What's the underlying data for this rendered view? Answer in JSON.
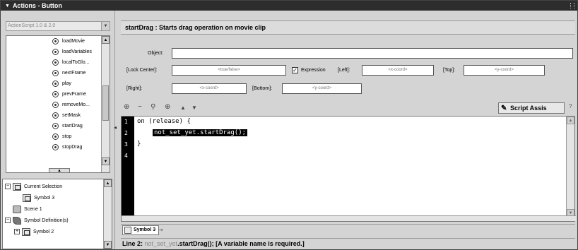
{
  "window": {
    "title": "Actions - Button"
  },
  "left_panel": {
    "language_select": "ActionScript 1.0 & 2.0",
    "toolbox_items": [
      "loadMovie",
      "loadVariables",
      "localToGlo...",
      "nextFrame",
      "play",
      "prevFrame",
      "removeMo...",
      "setMask",
      "startDrag",
      "stop",
      "stopDrag"
    ],
    "tree": {
      "current_selection": "Current Selection",
      "symbol3": "Symbol 3",
      "scene1": "Scene 1",
      "symbol_definitions": "Symbol Definition(s)",
      "symbol2": "Symbol 2"
    }
  },
  "header": {
    "title": "startDrag : Starts drag operation on movie clip"
  },
  "params": {
    "object_label": "Object:",
    "object_value": "",
    "lock_center_label": "[Lock Center]:",
    "lock_center_placeholder": "<true/false>",
    "expression_label": "Expression",
    "left_label": "[Left]:",
    "left_placeholder": "<x-coord>",
    "top_label": "[Top]:",
    "top_placeholder": "<y-coord>",
    "right_label": "[Right]:",
    "right_placeholder": "<x-coord>",
    "bottom_label": "[Bottom]:",
    "bottom_placeholder": "<y-coord>"
  },
  "toolbar": {
    "script_assist_label": "Script Assis"
  },
  "editor": {
    "line_numbers": [
      "1",
      "2",
      "3",
      "4"
    ],
    "line1": "on (release) {",
    "line2": "not_set_yet.startDrag();",
    "line3": "}"
  },
  "tabs": {
    "symbol3": "Symbol 3"
  },
  "status": {
    "prefix": "Line 2: ",
    "muted": "not_set_yet",
    "rest": ".startDrag(); [A variable name is required.]"
  }
}
